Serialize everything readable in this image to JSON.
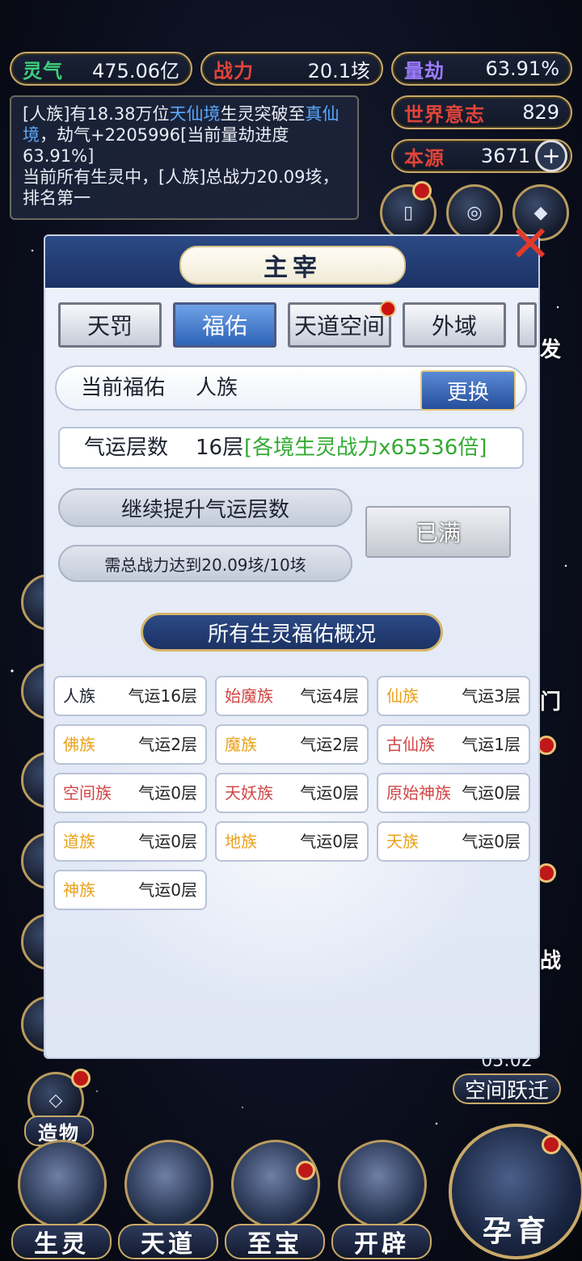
{
  "resources": {
    "lingqi": {
      "label": "灵气",
      "value": "475.06亿",
      "color": "#3fcf7a"
    },
    "zhanli": {
      "label": "战力",
      "value": "20.1垓",
      "color": "#e0443a"
    },
    "liangjie": {
      "label": "量劫",
      "value": "63.91%",
      "color": "#9b7cff"
    },
    "shijie": {
      "label": "世界意志",
      "value": "829",
      "color": "#e0443a"
    },
    "benyuan": {
      "label": "本源",
      "value": "3671",
      "color": "#e0443a"
    }
  },
  "news": {
    "line1_a": "[人族]有18.38万位",
    "line1_b": "天仙境",
    "line1_c": "生灵突破至",
    "line1_d": "真仙境",
    "line1_e": "，劫气+2205996[当前量劫进度63.91%]",
    "line2": "当前所有生灵中，[人族]总战力20.09垓，排名第一"
  },
  "side": {
    "right_label1": "发",
    "right_label2": "门",
    "right_label3": "战",
    "left_label": "造物",
    "timer": "05:02",
    "space_jump": "空间跃迁"
  },
  "bottom_nav": [
    "生灵",
    "天道",
    "至宝",
    "开辟"
  ],
  "big_button": "孕育",
  "panel": {
    "title": "主宰",
    "tabs": [
      "天罚",
      "福佑",
      "天道空间",
      "外域"
    ],
    "active_tab": "福佑",
    "current_blessing_label": "当前福佑",
    "current_blessing_value": "人族",
    "change_button": "更换",
    "luck_label": "气运层数",
    "luck_value": "16层",
    "luck_effect": "[各境生灵战力x65536倍]",
    "upgrade_button": "继续提升气运层数",
    "requirement": "需总战力达到20.09垓/10垓",
    "full_button": "已满",
    "section_title": "所有生灵福佑概况",
    "races": [
      {
        "name": "人族",
        "luck": "气运16层",
        "color": "dark"
      },
      {
        "name": "始魔族",
        "luck": "气运4层",
        "color": "red"
      },
      {
        "name": "仙族",
        "luck": "气运3层",
        "color": "orange"
      },
      {
        "name": "佛族",
        "luck": "气运2层",
        "color": "orange"
      },
      {
        "name": "魔族",
        "luck": "气运2层",
        "color": "orange"
      },
      {
        "name": "古仙族",
        "luck": "气运1层",
        "color": "red"
      },
      {
        "name": "空间族",
        "luck": "气运0层",
        "color": "red"
      },
      {
        "name": "天妖族",
        "luck": "气运0层",
        "color": "red"
      },
      {
        "name": "原始神族",
        "luck": "气运0层",
        "color": "red"
      },
      {
        "name": "道族",
        "luck": "气运0层",
        "color": "orange"
      },
      {
        "name": "地族",
        "luck": "气运0层",
        "color": "orange"
      },
      {
        "name": "天族",
        "luck": "气运0层",
        "color": "orange"
      },
      {
        "name": "神族",
        "luck": "气运0层",
        "color": "orange"
      }
    ]
  }
}
